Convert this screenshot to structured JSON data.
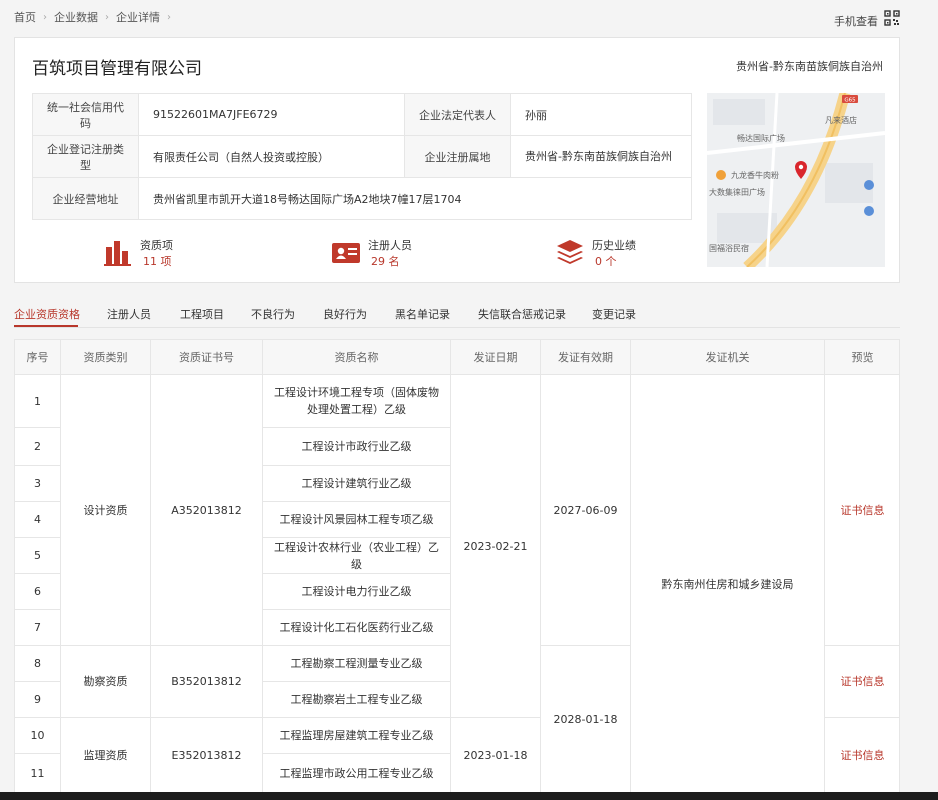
{
  "breadcrumb": [
    "首页",
    "企业数据",
    "企业详情"
  ],
  "mobile_view_label": "手机查看",
  "company": {
    "name": "百筑项目管理有限公司",
    "region": "贵州省-黔东南苗族侗族自治州",
    "fields": {
      "credit_code_key": "统一社会信用代码",
      "credit_code": "91522601MA7JFE6729",
      "legal_rep_key": "企业法定代表人",
      "legal_rep": "孙丽",
      "reg_type_key": "企业登记注册类型",
      "reg_type": "有限责任公司（自然人投资或控股）",
      "reg_place_key": "企业注册属地",
      "reg_place": "贵州省-黔东南苗族侗族自治州",
      "address_key": "企业经营地址",
      "address": "贵州省凯里市凯开大道18号畅达国际广场A2地块7幢17层1704"
    },
    "stats": [
      {
        "label": "资质项",
        "value": "11 项",
        "icon": "building-chart-icon"
      },
      {
        "label": "注册人员",
        "value": "29 名",
        "icon": "person-card-icon"
      },
      {
        "label": "历史业绩",
        "value": "0 个",
        "icon": "layers-icon"
      }
    ],
    "map_labels": [
      "畅达国际广场",
      "凡来酒店",
      "九龙香牛肉粉",
      "大数集徕田广场",
      "国福浴民宿",
      "G65"
    ]
  },
  "tabs": [
    "企业资质资格",
    "注册人员",
    "工程项目",
    "不良行为",
    "良好行为",
    "黑名单记录",
    "失信联合惩戒记录",
    "变更记录"
  ],
  "active_tab": 0,
  "table": {
    "headers": [
      "序号",
      "资质类别",
      "资质证书号",
      "资质名称",
      "发证日期",
      "发证有效期",
      "发证机关",
      "预览"
    ],
    "rows": [
      {
        "no": "1",
        "name": "工程设计环境工程专项（固体废物处理处置工程）乙级"
      },
      {
        "no": "2",
        "name": "工程设计市政行业乙级"
      },
      {
        "no": "3",
        "name": "工程设计建筑行业乙级"
      },
      {
        "no": "4",
        "name": "工程设计风景园林工程专项乙级"
      },
      {
        "no": "5",
        "name": "工程设计农林行业（农业工程）乙级"
      },
      {
        "no": "6",
        "name": "工程设计电力行业乙级"
      },
      {
        "no": "7",
        "name": "工程设计化工石化医药行业乙级"
      },
      {
        "no": "8",
        "name": "工程勘察工程测量专业乙级"
      },
      {
        "no": "9",
        "name": "工程勘察岩土工程专业乙级"
      },
      {
        "no": "10",
        "name": "工程监理房屋建筑工程专业乙级"
      },
      {
        "no": "11",
        "name": "工程监理市政公用工程专业乙级"
      }
    ],
    "groups": [
      {
        "category": "设计资质",
        "cert_no": "A352013812",
        "preview": "证书信息"
      },
      {
        "category": "勘察资质",
        "cert_no": "B352013812",
        "preview": "证书信息"
      },
      {
        "category": "监理资质",
        "cert_no": "E352013812",
        "preview": "证书信息"
      }
    ],
    "issue_dates": [
      "2023-02-21",
      "2023-01-18"
    ],
    "valid_dates": [
      "2027-06-09",
      "2028-01-18"
    ],
    "authority": "黔东南州住房和城乡建设局"
  },
  "colors": {
    "accent": "#b8372b",
    "header_bg": "#f7f7f7",
    "border": "#e6e6e6"
  }
}
